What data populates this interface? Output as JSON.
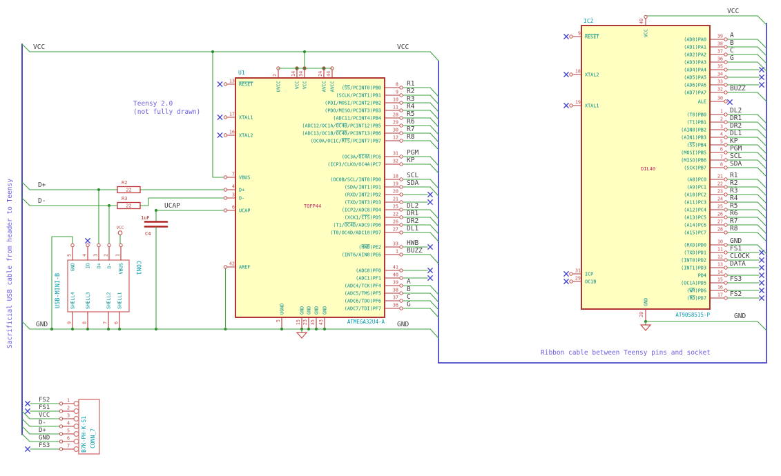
{
  "colors": {
    "wire": "#3EA13E",
    "junction": "#2E8F2E",
    "bus": "#4A4AC8",
    "note": "#6B5FE3",
    "nc": "#4646CC",
    "body_fill": "#FFFFC2",
    "body_stroke": "#B23535",
    "pin_stub": "#B23535",
    "pin_num": "#C34A4A",
    "pin_name": "#008A8A",
    "ref": "#009AAB",
    "value": "#C22863",
    "net_label": "#3D3D3D",
    "conn": "#D47474",
    "cap": "#B02020"
  },
  "notes": {
    "teensy_1": "Teensy 2.0",
    "teensy_2": "(not fully drawn)",
    "usb_cable": "Sacrificial USB cable from header to Teensy",
    "ribbon": "Ribbon cable between Teensy pins and socket"
  },
  "left_nets": {
    "vcc": "VCC",
    "vcc_right": "VCC",
    "gnd": "GND",
    "gnd_right": "GND",
    "dplus": "D+",
    "dminus": "D-",
    "ucap": "UCAP"
  },
  "right_nets": {
    "vcc": "VCC",
    "gnd": "GND"
  },
  "r2": {
    "ref": "R2",
    "value": "22"
  },
  "r3": {
    "ref": "R3",
    "value": "22"
  },
  "c4": {
    "ref": "C4",
    "value": "1uF"
  },
  "vcc_symbol": {
    "label": "VCC"
  },
  "u1": {
    "ref": "U1",
    "value": "TQFP44",
    "part": "ATMEGA32U4-A",
    "top_pins": [
      {
        "num": "2",
        "name": "UVCC"
      },
      {
        "num": "14",
        "name": "VCC"
      },
      {
        "num": "34",
        "name": "VCC"
      },
      {
        "num": "24",
        "name": "AVCC"
      },
      {
        "num": "44",
        "name": "AVCC"
      }
    ],
    "bottom_pins": [
      {
        "num": "5",
        "name": "UGND"
      },
      {
        "num": "15",
        "name": "GND"
      },
      {
        "num": "23",
        "name": "GND"
      },
      {
        "num": "35",
        "name": "GND"
      },
      {
        "num": "43",
        "name": "GND"
      }
    ],
    "left_pins": [
      {
        "num": "13",
        "name": "{RESET}",
        "nc": true
      },
      {
        "num": "17",
        "name": "XTAL1",
        "nc": true
      },
      {
        "num": "16",
        "name": "XTAL2",
        "nc": true
      },
      {
        "num": "7",
        "name": "VBUS"
      },
      {
        "num": "4",
        "name": "D+"
      },
      {
        "num": "3",
        "name": "D-"
      },
      {
        "num": "6",
        "name": "UCAP"
      },
      {
        "num": "42",
        "name": "AREF"
      }
    ],
    "right_groups": [
      {
        "pins": [
          {
            "num": "8",
            "name": "({SS}/PCINT0)PB0",
            "label": "R1",
            "end": "bus"
          },
          {
            "num": "9",
            "name": "(SCLK/PCINT1)PB1",
            "label": "R2",
            "end": "bus"
          },
          {
            "num": "10",
            "name": "(PDI/MOSI/PCINT2)PB2",
            "label": "R3",
            "end": "bus"
          },
          {
            "num": "11",
            "name": "(PDO/MISO/PCINT3)PB3",
            "label": "R4",
            "end": "bus"
          },
          {
            "num": "28",
            "name": "(ADC11/PCINT4)PB4",
            "label": "R5",
            "end": "bus"
          },
          {
            "num": "29",
            "name": "(ADC12/OC1A/{OC4B}/PCINT12)PB5",
            "label": "R6",
            "end": "bus"
          },
          {
            "num": "30",
            "name": "(ADC13/OC1B/{OC4B}/PCINT13)PB6",
            "label": "R7",
            "end": "bus"
          },
          {
            "num": "12",
            "name": "(OC0A/OC1C/{RTS}/PCINT7)PB7",
            "label": "R8",
            "end": "bus"
          }
        ]
      },
      {
        "pins": [
          {
            "num": "31",
            "name": "(OC3A/{OC4A})PC6",
            "label": "PGM",
            "end": "bus"
          },
          {
            "num": "32",
            "name": "(ICP3/CLK0/OC4A)PC7",
            "label": "KP",
            "end": "bus"
          }
        ]
      },
      {
        "pins": [
          {
            "num": "18",
            "name": "(OC0B/SCL/INT0)PD0",
            "label": "SCL",
            "end": "bus"
          },
          {
            "num": "19",
            "name": "(SDA/INT1)PD1",
            "label": "SDA",
            "end": "bus"
          },
          {
            "num": "20",
            "name": "(RXD/INT2)PD2",
            "label": "",
            "end": "nc"
          },
          {
            "num": "21",
            "name": "(TXD/INT3)PD3",
            "label": "",
            "end": "nc"
          },
          {
            "num": "25",
            "name": "(ICP2/ADC8)PD4",
            "label": "DL2",
            "end": "bus"
          },
          {
            "num": "22",
            "name": "(XCK1/{CTS})PD5",
            "label": "DR1",
            "end": "bus"
          },
          {
            "num": "26",
            "name": "(T1/{OC4D}/ADC9)PD6",
            "label": "DR2",
            "end": "bus"
          },
          {
            "num": "27",
            "name": "(T0/OC4D/ADC10)PD7",
            "label": "DL1",
            "end": "bus"
          }
        ]
      },
      {
        "pins": [
          {
            "num": "33",
            "name": "({HWB})PE2",
            "label": "HWB",
            "end": "nc"
          },
          {
            "num": "1",
            "name": "(INT6/AIN0)PE6",
            "label": "BUZZ",
            "end": "bus"
          }
        ]
      },
      {
        "pins": [
          {
            "num": "41",
            "name": "(ADC0)PF0",
            "label": "",
            "end": "nc"
          },
          {
            "num": "40",
            "name": "(ADC1)PF1",
            "label": "",
            "end": "nc"
          },
          {
            "num": "39",
            "name": "(ADC4/TCK)PF4",
            "label": "A",
            "end": "bus"
          },
          {
            "num": "38",
            "name": "(ADC5/TMS)PF5",
            "label": "B",
            "end": "bus"
          },
          {
            "num": "37",
            "name": "(ADC6/TDO)PF6",
            "label": "C",
            "end": "bus"
          },
          {
            "num": "36",
            "name": "(ADC7/TDI)PF7",
            "label": "G",
            "end": "bus"
          }
        ]
      }
    ]
  },
  "ic2": {
    "ref": "IC2",
    "value": "DIL40",
    "part": "AT90S8515-P",
    "top_pin": {
      "num": "40",
      "name": "VCC"
    },
    "bottom_pin": {
      "num": "20",
      "name": "GND"
    },
    "left_pins": [
      {
        "num": "9",
        "name": "{RESET}"
      },
      {
        "num": "18",
        "name": "XTAL2"
      },
      {
        "num": "19",
        "name": "XTAL1"
      },
      {
        "num": "31",
        "name": "ICP"
      },
      {
        "num": "29",
        "name": "OC1B"
      }
    ],
    "right_groups": [
      {
        "pins": [
          {
            "num": "39",
            "name": "(AD0)PA0",
            "label": "A",
            "end": "bus"
          },
          {
            "num": "38",
            "name": "(AD1)PA1",
            "label": "B",
            "end": "bus"
          },
          {
            "num": "37",
            "name": "(AD2)PA2",
            "label": "C",
            "end": "bus"
          },
          {
            "num": "36",
            "name": "(AD3)PA3",
            "label": "G",
            "end": "bus"
          },
          {
            "num": "35",
            "name": "(AD4)PA4",
            "label": "",
            "end": "nc"
          },
          {
            "num": "34",
            "name": "(AD5)PA5",
            "label": "",
            "end": "nc"
          },
          {
            "num": "33",
            "name": "(AD6)PA6",
            "label": "",
            "end": "nc"
          },
          {
            "num": "32",
            "name": "(AD7)PA7",
            "label": "BUZZ",
            "end": "bus"
          }
        ]
      },
      {
        "pins": [
          {
            "num": "30",
            "name": "ALE",
            "label": "",
            "end": "ncpin"
          }
        ]
      },
      {
        "pins": [
          {
            "num": "1",
            "name": "(T0)PB0",
            "label": "DL2",
            "end": "bus"
          },
          {
            "num": "2",
            "name": "(T1)PB1",
            "label": "DR1",
            "end": "bus"
          },
          {
            "num": "3",
            "name": "(AIN0)PB2",
            "label": "DR2",
            "end": "bus"
          },
          {
            "num": "4",
            "name": "(AIN1)PB3",
            "label": "DL1",
            "end": "bus"
          },
          {
            "num": "5",
            "name": "({SS})PB4",
            "label": "KP",
            "end": "bus"
          },
          {
            "num": "6",
            "name": "(MOSI)PB5",
            "label": "PGM",
            "end": "bus"
          },
          {
            "num": "7",
            "name": "(MISO)PB6",
            "label": "SCL",
            "end": "bus"
          },
          {
            "num": "8",
            "name": "(SCK)PB7",
            "label": "SDA",
            "end": "bus"
          }
        ]
      },
      {
        "pins": [
          {
            "num": "21",
            "name": "(A8)PC0",
            "label": "R1",
            "end": "bus"
          },
          {
            "num": "22",
            "name": "(A9)PC1",
            "label": "R2",
            "end": "bus"
          },
          {
            "num": "23",
            "name": "(A10)PC2",
            "label": "R3",
            "end": "bus"
          },
          {
            "num": "24",
            "name": "(A11)PC3",
            "label": "R4",
            "end": "bus"
          },
          {
            "num": "25",
            "name": "(A12)PC4",
            "label": "R5",
            "end": "bus"
          },
          {
            "num": "26",
            "name": "(A13)PC5",
            "label": "R6",
            "end": "bus"
          },
          {
            "num": "27",
            "name": "(A14)PC6",
            "label": "R7",
            "end": "bus"
          },
          {
            "num": "28",
            "name": "(A15)PC7",
            "label": "R8",
            "end": "bus"
          }
        ]
      },
      {
        "pins": [
          {
            "num": "10",
            "name": "(RXD)PD0",
            "label": "GND",
            "end": "bus"
          },
          {
            "num": "11",
            "name": "(TXD)PD1",
            "label": "FS1",
            "end": "nc"
          },
          {
            "num": "12",
            "name": "(INT0)PD2",
            "label": "CLOCK",
            "end": "nc"
          },
          {
            "num": "13",
            "name": "(INT1)PD3",
            "label": "DATA",
            "end": "nc"
          },
          {
            "num": "14",
            "name": "PD4",
            "label": "",
            "end": "nc"
          },
          {
            "num": "15",
            "name": "(OC1A)PD5",
            "label": "FS3",
            "end": "nc"
          },
          {
            "num": "16",
            "name": "({WR})PD6",
            "label": "",
            "end": "nc"
          },
          {
            "num": "17",
            "name": "({RD})PD7",
            "label": "FS2",
            "end": "nc"
          }
        ]
      }
    ]
  },
  "con1": {
    "ref": "CON1",
    "part": "USB-MINI-B",
    "top_pins": [
      {
        "num": "5",
        "name": "GND"
      },
      {
        "num": "4",
        "name": "ID"
      },
      {
        "num": "3",
        "name": "D+"
      },
      {
        "num": "2",
        "name": "D-"
      },
      {
        "num": "1",
        "name": "VBUS"
      }
    ],
    "bottom_pins": [
      {
        "num": "9",
        "name": "SHELL4"
      },
      {
        "num": "8",
        "name": "SHELL3"
      },
      {
        "num": "7",
        "name": "SHELL2"
      },
      {
        "num": "6",
        "name": "SHELL1"
      }
    ]
  },
  "conn7": {
    "ref": "CONN_7",
    "part": "B7K-PH-K-S1",
    "pins": [
      {
        "num": "1",
        "label": "FS2",
        "end": "nc"
      },
      {
        "num": "2",
        "label": "FS1",
        "end": "nc"
      },
      {
        "num": "3",
        "label": "VCC",
        "end": "bus"
      },
      {
        "num": "4",
        "label": "D-",
        "end": "bus"
      },
      {
        "num": "5",
        "label": "D+",
        "end": "bus"
      },
      {
        "num": "6",
        "label": "GND",
        "end": "bus"
      },
      {
        "num": "7",
        "label": "FS3",
        "end": "nc"
      }
    ]
  }
}
